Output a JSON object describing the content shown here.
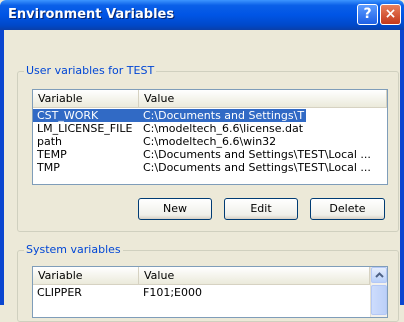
{
  "window": {
    "title": "Environment Variables",
    "help_glyph": "?",
    "close_glyph": "×"
  },
  "user_group": {
    "label": "User variables for TEST",
    "columns": [
      "Variable",
      "Value"
    ],
    "rows": [
      {
        "variable": "CST_WORK",
        "value": "C:\\Documents and Settings\\TEST\\My D...",
        "selected": true
      },
      {
        "variable": "LM_LICENSE_FILE",
        "value": "C:\\modeltech_6.6\\license.dat",
        "selected": false
      },
      {
        "variable": "path",
        "value": "C:\\modeltech_6.6\\win32",
        "selected": false
      },
      {
        "variable": "TEMP",
        "value": "C:\\Documents and Settings\\TEST\\Local ...",
        "selected": false
      },
      {
        "variable": "TMP",
        "value": "C:\\Documents and Settings\\TEST\\Local ...",
        "selected": false
      }
    ],
    "buttons": {
      "new": "New",
      "edit": "Edit",
      "delete": "Delete"
    }
  },
  "system_group": {
    "label": "System variables",
    "columns": [
      "Variable",
      "Value"
    ],
    "rows": [
      {
        "variable": "CLIPPER",
        "value": "F101;E000"
      }
    ]
  },
  "colors": {
    "title_bar": "#0055e5",
    "group_label": "#0046d5",
    "selection": "#316ac5",
    "dialog_bg": "#ece9d8"
  }
}
